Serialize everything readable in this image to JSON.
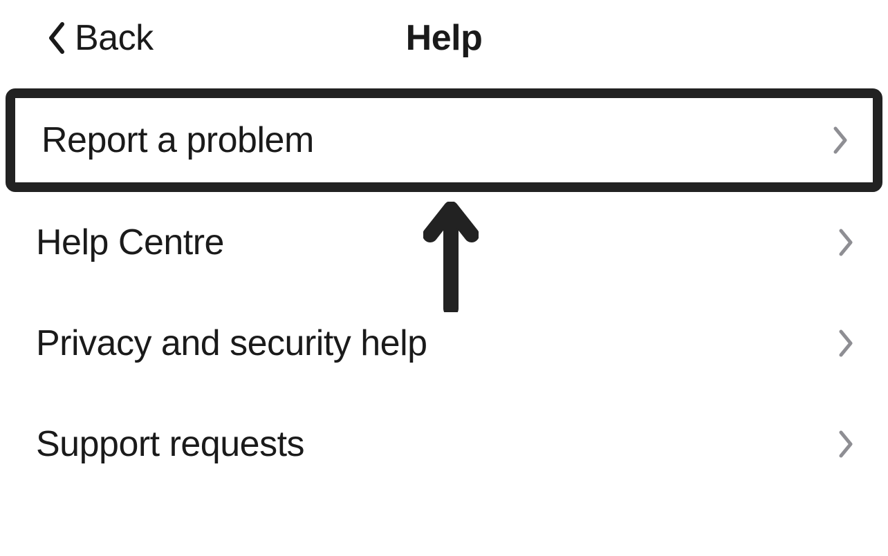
{
  "header": {
    "back_label": "Back",
    "title": "Help"
  },
  "items": [
    {
      "label": "Report a problem",
      "highlighted": true
    },
    {
      "label": "Help Centre",
      "highlighted": false
    },
    {
      "label": "Privacy and security help",
      "highlighted": false
    },
    {
      "label": "Support requests",
      "highlighted": false
    }
  ],
  "colors": {
    "text": "#1a1a1a",
    "chevron_grey": "#8e8e93",
    "highlight_border": "#222222",
    "background": "#ffffff"
  }
}
